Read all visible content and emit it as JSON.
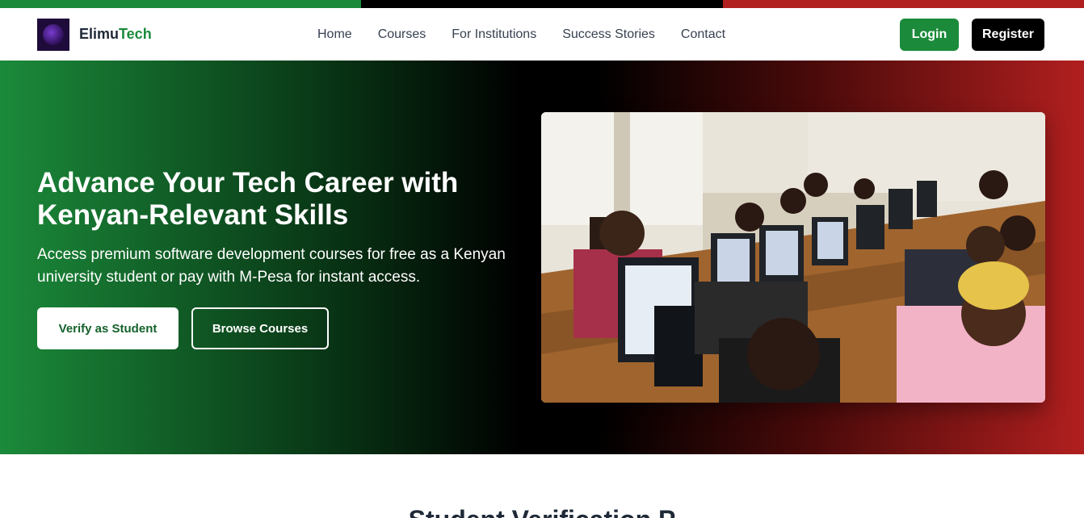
{
  "brand": {
    "name_part1": "Elimu",
    "name_part2": "Tech",
    "logo_icon": "elimutech-logo"
  },
  "nav": {
    "items": [
      "Home",
      "Courses",
      "For Institutions",
      "Success Stories",
      "Contact"
    ]
  },
  "auth": {
    "login_label": "Login",
    "register_label": "Register"
  },
  "hero": {
    "title": "Advance Your Tech Career with Kenyan-Relevant Skills",
    "subtitle": "Access premium software development courses for free as a Kenyan university student or pay with M-Pesa for instant access.",
    "verify_label": "Verify as Student",
    "browse_label": "Browse Courses",
    "image_alt": "Students in a computer lab"
  },
  "next_section": {
    "title": "Student Verification P"
  },
  "colors": {
    "green": "#1b8a3a",
    "black": "#000000",
    "red": "#b11f1f",
    "white": "#ffffff"
  }
}
